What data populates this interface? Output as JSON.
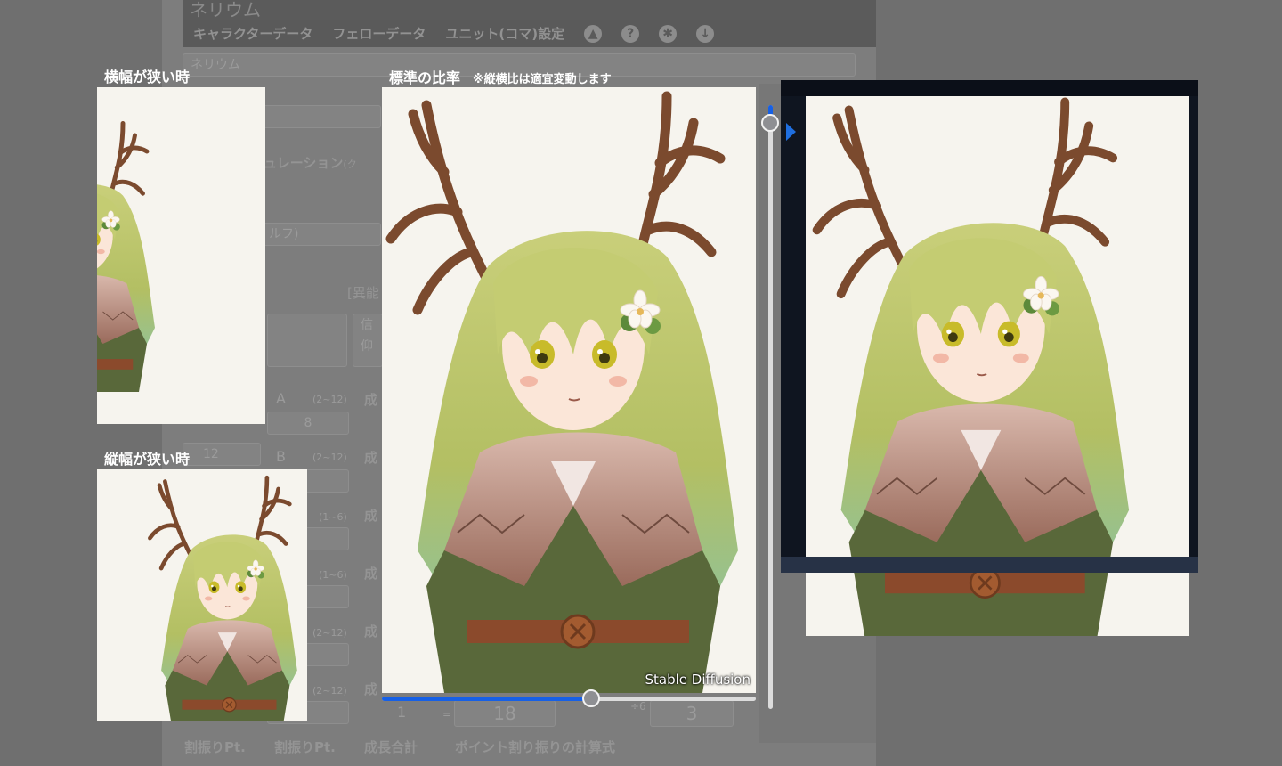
{
  "background_app": {
    "title": "ネリウム",
    "menu": [
      "キャラクターデータ",
      "フェローデータ",
      "ユニット(コマ)設定"
    ],
    "menu_icons": [
      "paint-bucket-icon",
      "help-icon",
      "gear-icon",
      "download-icon"
    ],
    "name_value": "ネリウム",
    "emulation_label": "ュレーション",
    "emulation_hint": "(ク",
    "race_hint": "ルフ)",
    "bracket_label": "[異能",
    "trust_label": "信仰",
    "stat_a": "A",
    "stat_a_range": "(2~12)",
    "stat_a_value": "8",
    "stat_b": "B",
    "stat_b_range": "(2~12)",
    "value_12": "12",
    "range_1_6_a": "(1~6)",
    "range_1_6_b": "(1~6)",
    "range_2_12_c": "(2~12)",
    "range_2_12_d": "(2~12)",
    "growth_label": "成",
    "total_1": "1",
    "total_18": "18",
    "total_3": "3",
    "div_6": "÷6",
    "equals": "=",
    "footer_labels": [
      "割振りPt.",
      "割振りPt.",
      "成長合計",
      "ポイント割り振りの計算式"
    ]
  },
  "captions": {
    "narrow_width": "横幅が狭い時",
    "narrow_height": "縦幅が狭い時",
    "standard_ratio": "標準の比率",
    "standard_note": "※縦横比は適宜変動します"
  },
  "image": {
    "credit": "Stable Diffusion"
  },
  "sliders": {
    "horizontal_value": 0.56,
    "vertical_value": 0.03
  },
  "colors": {
    "accent": "#1660e6",
    "hair": "#b9c46a",
    "antler": "#7b4a2e",
    "cloak": "#5a6a3a"
  }
}
